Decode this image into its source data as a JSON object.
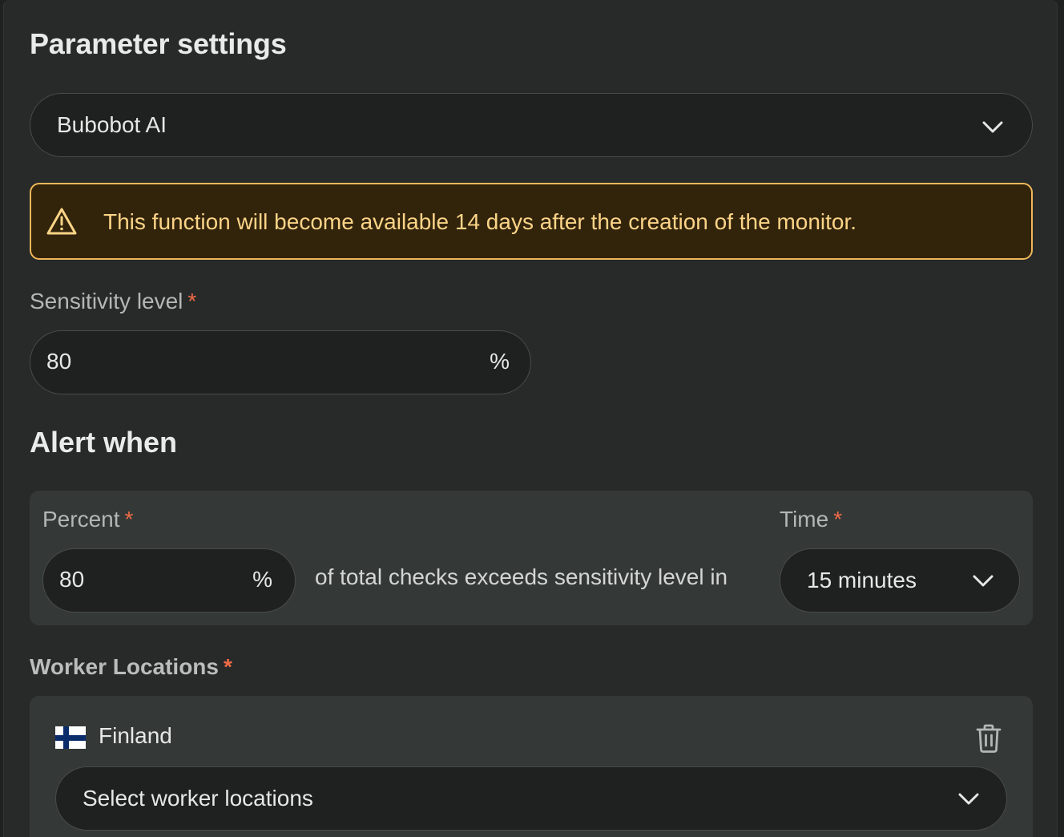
{
  "page": {
    "title": "Parameter settings"
  },
  "model_select": {
    "value": "Bubobot AI",
    "icon": "chevron-down-icon"
  },
  "warning": {
    "icon": "warning-triangle-icon",
    "text": "This function will become available 14 days after the creation of the monitor.",
    "colors": {
      "background": "#32230b",
      "border": "#f0b75a",
      "text": "#fbd487"
    }
  },
  "sensitivity": {
    "label": "Sensitivity level",
    "required_mark": "*",
    "value": "80",
    "unit": "%"
  },
  "alert_when": {
    "heading": "Alert when",
    "percent_label": "Percent",
    "percent_value": "80",
    "percent_unit": "%",
    "middle_text": "of total checks exceeds sensitivity level in",
    "time_label": "Time",
    "time_value": "15 minutes",
    "required_mark": "*"
  },
  "worker_locations": {
    "label": "Worker Locations",
    "required_mark": "*",
    "country": "Finland",
    "flag_icon": "finland-flag-icon",
    "delete_icon": "trash-icon",
    "placeholder": "Select worker locations"
  },
  "colors": {
    "required": "#f06b47",
    "panel": "#272a29",
    "input_bg": "#1f2120"
  }
}
